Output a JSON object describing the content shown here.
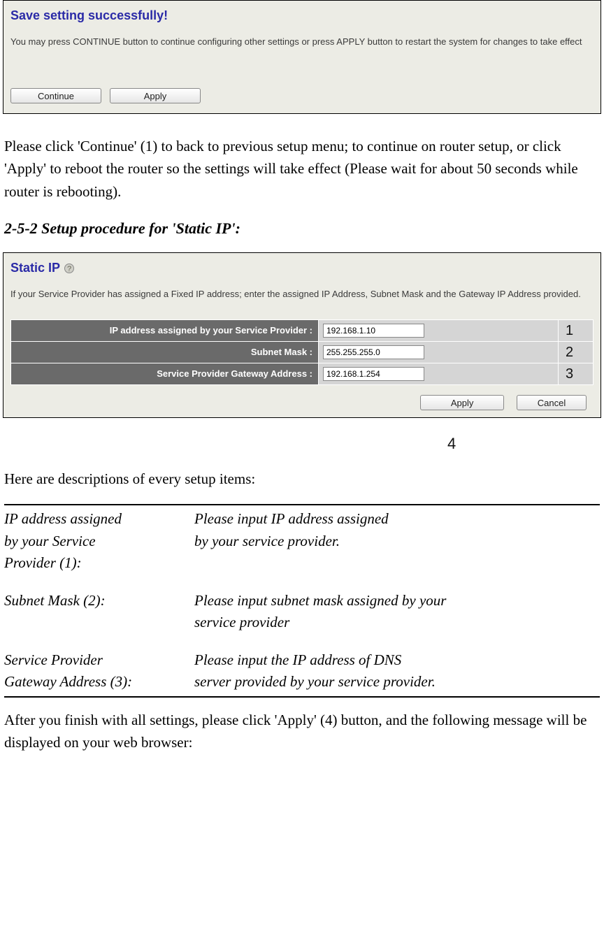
{
  "panel1": {
    "heading": "Save setting successfully!",
    "desc": "You may press CONTINUE button to continue configuring other settings or press APPLY button to restart the system for changes to take effect",
    "continue_btn": "Continue",
    "apply_btn": "Apply"
  },
  "text1": "Please click 'Continue' (1) to back to previous setup menu; to continue on router setup, or click 'Apply' to reboot the router so the settings will take effect (Please wait for about 50 seconds while router is rebooting).",
  "section_heading": "2-5-2 Setup procedure for 'Static IP':",
  "panel2": {
    "heading": "Static IP",
    "desc": "If your Service Provider has assigned a Fixed IP address; enter the assigned IP Address, Subnet Mask and the Gateway IP Address provided.",
    "rows": [
      {
        "label": "IP address assigned by your Service Provider :",
        "value": "192.168.1.10",
        "num": "1"
      },
      {
        "label": "Subnet Mask :",
        "value": "255.255.255.0",
        "num": "2"
      },
      {
        "label": "Service Provider Gateway Address :",
        "value": "192.168.1.254",
        "num": "3"
      }
    ],
    "apply_btn": "Apply",
    "cancel_btn": "Cancel"
  },
  "annotation4": "4",
  "text2": "Here are descriptions of every setup items:",
  "desc_items": [
    {
      "name": "IP address assigned by your Service Provider (1):",
      "desc": "Please input IP address assigned by your service provider."
    },
    {
      "name": "Subnet Mask (2):",
      "desc": "Please input subnet mask assigned by your service provider"
    },
    {
      "name": "Service Provider Gateway Address (3):",
      "desc": "Please input the IP address of DNS server provided by your service provider."
    }
  ],
  "text3": "After you finish with all settings, please click 'Apply' (4) button, and the following message will be displayed on your web browser:"
}
